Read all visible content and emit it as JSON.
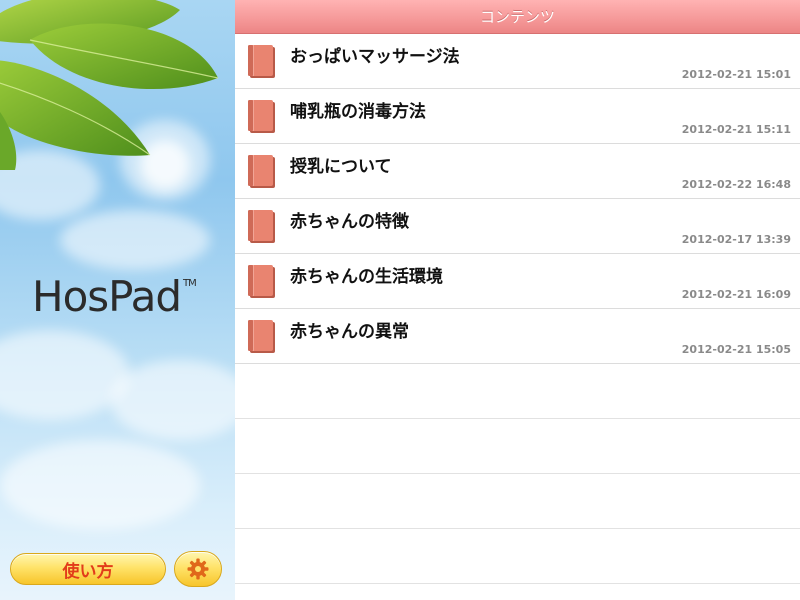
{
  "sidebar": {
    "logo_text": "HosPad",
    "logo_tm": "TM",
    "help_label": "使い方",
    "settings_icon": "gear-icon"
  },
  "header": {
    "title": "コンテンツ"
  },
  "items": [
    {
      "title": "おっぱいマッサージ法",
      "date": "2012-02-21 15:01",
      "icon": "book-icon"
    },
    {
      "title": "哺乳瓶の消毒方法",
      "date": "2012-02-21 15:11",
      "icon": "book-icon"
    },
    {
      "title": "授乳について",
      "date": "2012-02-22 16:48",
      "icon": "book-icon"
    },
    {
      "title": "赤ちゃんの特徴",
      "date": "2012-02-17 13:39",
      "icon": "book-icon"
    },
    {
      "title": "赤ちゃんの生活環境",
      "date": "2012-02-21 16:09",
      "icon": "book-icon"
    },
    {
      "title": "赤ちゃんの異常",
      "date": "2012-02-21 15:05",
      "icon": "book-icon"
    }
  ],
  "colors": {
    "header_pink": "#f69a9a",
    "button_yellow": "#ffe36a",
    "help_text_red": "#e23c1a",
    "book_salmon": "#e98470"
  }
}
